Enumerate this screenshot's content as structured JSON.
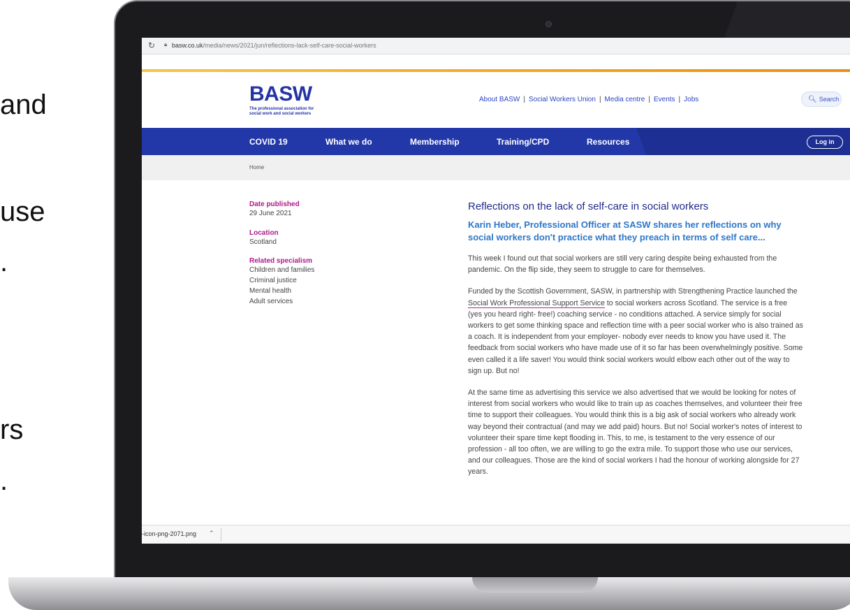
{
  "side_text": [
    "and",
    "use",
    ".",
    "rs",
    "."
  ],
  "browser": {
    "url_domain": "basw.co.uk",
    "url_path": "/media/news/2021/jun/reflections-lack-self-care-social-workers",
    "download_file": "-icon-png-2071.png"
  },
  "site": {
    "logo": "BASW",
    "tagline": "The professional association for social work and social workers",
    "top_links": [
      "About BASW",
      "Social Workers Union",
      "Media centre",
      "Events",
      "Jobs"
    ],
    "top_link_separator": "|",
    "search_label": "Search",
    "nav": [
      "COVID 19",
      "What we do",
      "Membership",
      "Training/CPD",
      "Resources"
    ],
    "login_label": "Log in",
    "breadcrumb": "Home"
  },
  "meta": {
    "date_label": "Date published",
    "date_value": "29 June 2021",
    "location_label": "Location",
    "location_value": "Scotland",
    "specialism_label": "Related specialism",
    "specialisms": [
      "Children and families",
      "Criminal justice",
      "Mental health",
      "Adult services"
    ]
  },
  "article": {
    "title": "Reflections on the lack of self-care in social workers",
    "subtitle": "Karin Heber, Professional Officer at SASW shares her reflections on why social workers don't practice what they preach in terms of self care...",
    "para1": "This week I found out that social workers are still very caring despite being exhausted from the pandemic. On the flip side, they seem to struggle to care for themselves.",
    "para2_before": "Funded by the Scottish Government, SASW, in partnership with Strengthening Practice launched the ",
    "para2_link": "Social Work Professional Support Service",
    "para2_after": " to social workers across Scotland. The service is a free (yes you heard right- free!) coaching service - no conditions attached. A service simply for social workers to get some thinking space and reflection time with a peer social worker who is also trained as a coach. It is independent from your employer- nobody ever needs to know you have used it. The feedback from social workers who have made use of it so far has been overwhelmingly positive. Some even called it a life saver! You would think social workers would elbow each other out of the way to sign up. But no!",
    "para3": "At the same time as advertising this service we also advertised that we would be looking for notes of interest from social workers who would like to train up as coaches themselves, and volunteer their free time to support their colleagues. You would think this is a big ask of social workers who already work way beyond their contractual (and may we add paid) hours. But no! Social worker's notes of interest to volunteer their spare time kept flooding in. This, to me, is testament to the very essence of our profession - all too often, we are willing to go the extra mile. To support those who use our services, and our colleagues. Those are the kind of social workers I had the honour of working alongside for 27 years."
  },
  "colors": {
    "brand_blue": "#2338a8",
    "accent_orange": "#f3a31a",
    "meta_magenta": "#b0198a",
    "subtitle_blue": "#2d77c9"
  },
  "icons": {
    "reload": "reload-icon",
    "lock": "lock-icon",
    "search": "search-icon",
    "chevron": "chevron-up-icon"
  }
}
